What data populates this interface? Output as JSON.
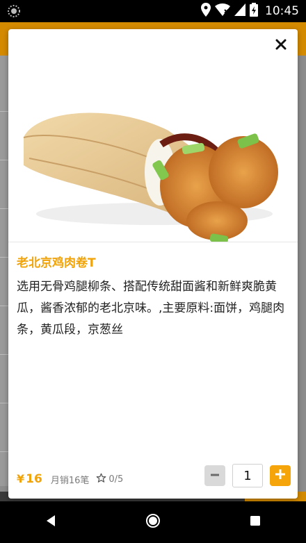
{
  "status_bar": {
    "time": "10:45",
    "icons": [
      "location-icon",
      "wifi-icon",
      "signal-icon",
      "battery-icon"
    ]
  },
  "dialog": {
    "close_icon": "close-icon",
    "product": {
      "name": "老北京鸡肉卷T",
      "description": "选用无骨鸡腿柳条、搭配传统甜面酱和新鲜爽脆黄瓜，酱香浓郁的老北京味。,主要原料:面饼，鸡腿肉条，黄瓜段，京葱丝",
      "currency_symbol": "¥",
      "price": "16",
      "monthly_sales": "月销16笔",
      "rating": "0/5",
      "quantity": "1"
    }
  },
  "navigation": {
    "icons": [
      "back-icon",
      "home-icon",
      "recents-icon"
    ]
  },
  "colors": {
    "accent": "#f5a50a",
    "price_text": "#f0a30a"
  }
}
